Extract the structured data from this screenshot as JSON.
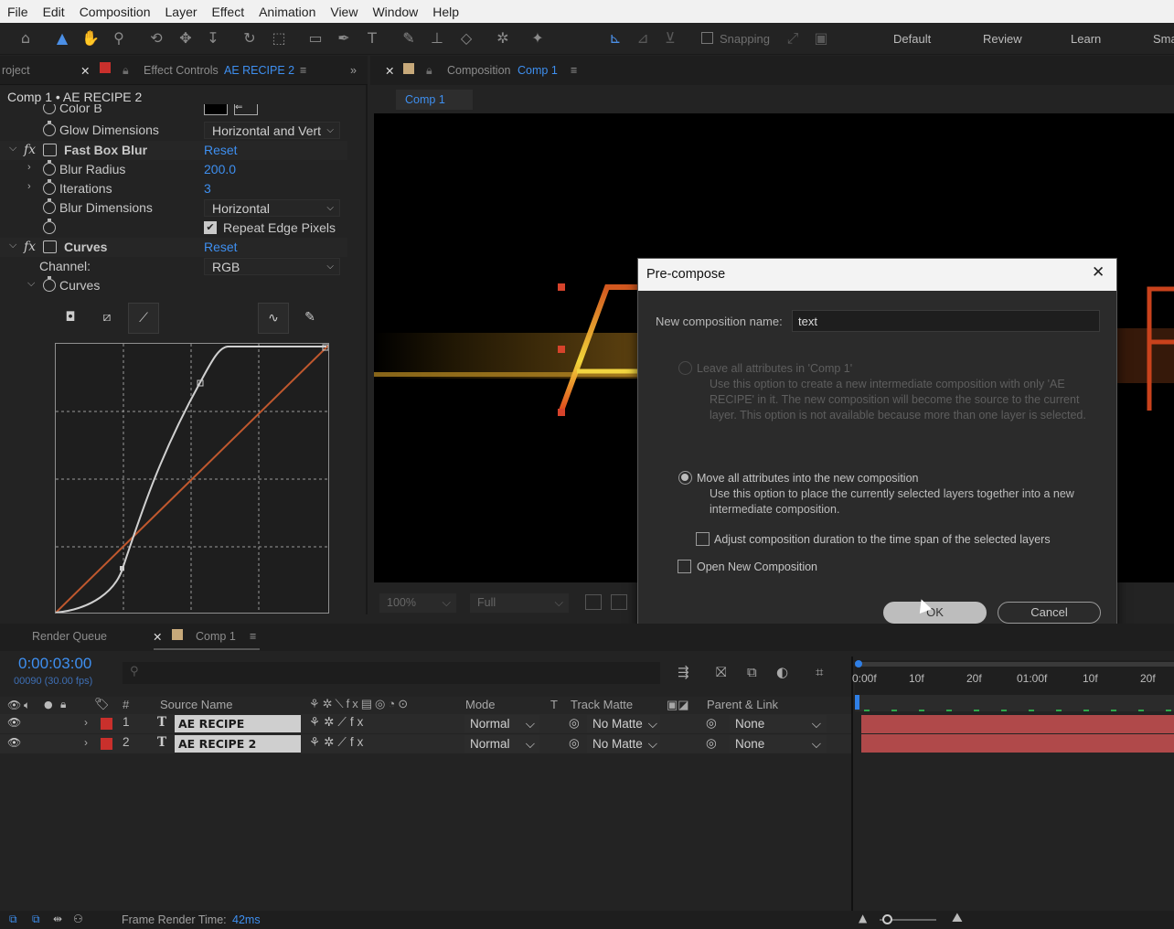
{
  "menu": [
    "File",
    "Edit",
    "Composition",
    "Layer",
    "Effect",
    "Animation",
    "View",
    "Window",
    "Help"
  ],
  "toolbar": {
    "snapping": "Snapping",
    "workspaces": [
      "Default",
      "Review",
      "Learn",
      "Sma"
    ]
  },
  "left_panel": {
    "tab_project": "roject",
    "tab_effect_prefix": "Effect Controls",
    "tab_effect_layer": "AE RECIPE 2",
    "breadcrumb": "Comp 1 • AE RECIPE 2",
    "rows": {
      "color_b": "Color B",
      "glow_dimensions": "Glow Dimensions",
      "glow_dimensions_value": "Horizontal and Vert",
      "fast_box_blur": "Fast Box Blur",
      "reset": "Reset",
      "blur_radius": "Blur Radius",
      "blur_radius_value": "200.0",
      "iterations": "Iterations",
      "iterations_value": "3",
      "blur_dimensions": "Blur Dimensions",
      "blur_dimensions_value": "Horizontal",
      "repeat_edge": "Repeat Edge Pixels",
      "curves": "Curves",
      "channel": "Channel:",
      "channel_value": "RGB",
      "curves_sub": "Curves"
    }
  },
  "comp_panel": {
    "tab_label": "Composition",
    "tab_comp": "Comp 1",
    "subtab": "Comp 1",
    "zoom": "100%",
    "quality": "Full"
  },
  "dialog": {
    "title": "Pre-compose",
    "name_label": "New composition name:",
    "name_value": "text",
    "opt1_label": "Leave all attributes in 'Comp 1'",
    "opt1_desc": "Use this option to create a new intermediate composition with only 'AE RECIPE' in it. The new composition will become the source to the current layer. This option is not available because more than one layer is selected.",
    "opt2_label": "Move all attributes into the new composition",
    "opt2_desc": "Use this option to place the currently selected layers together into a new intermediate composition.",
    "adjust_label": "Adjust composition duration to the time span of the selected layers",
    "open_label": "Open New Composition",
    "ok": "OK",
    "cancel": "Cancel"
  },
  "timeline": {
    "tab_render": "Render Queue",
    "tab_comp": "Comp 1",
    "timecode": "0:00:03:00",
    "frames": "00090 (30.00 fps)",
    "headers": {
      "num": "#",
      "source": "Source Name",
      "mode": "Mode",
      "t": "T",
      "matte": "Track Matte",
      "parent": "Parent & Link"
    },
    "ticks": [
      "0:00f",
      "10f",
      "20f",
      "01:00f",
      "10f",
      "20f"
    ],
    "layers": [
      {
        "num": "1",
        "name": "AE RECIPE",
        "mode": "Normal",
        "matte": "No Matte",
        "parent": "None"
      },
      {
        "num": "2",
        "name": "AE RECIPE 2",
        "mode": "Normal",
        "matte": "No Matte",
        "parent": "None"
      }
    ],
    "footer_label": "Frame Render Time:",
    "footer_value": "42ms"
  },
  "colors": {
    "accent": "#3e8ff0",
    "layer_label": "#c9302c",
    "bar": "#b0494a"
  }
}
